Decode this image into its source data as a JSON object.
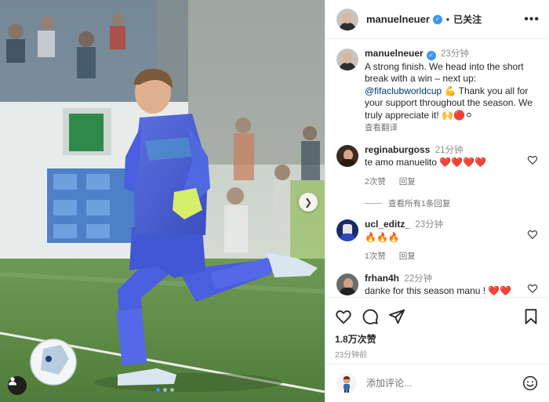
{
  "post": {
    "author": "manuelneuer",
    "follow_label": "已关注",
    "separator": "•",
    "more_label": "•••"
  },
  "caption": {
    "username": "manuelneuer",
    "time": "23分钟",
    "text_before_link": "A strong finish. We head into the short break with a win – next up: ",
    "link": "@fifaclubworldcup",
    "text_after_link": " 💪 Thank you all for your support throughout the season. We truly appreciate it! 🙌🔴⚪",
    "translate_label": "查看翻译"
  },
  "comments": [
    {
      "username": "reginaburgoss",
      "time": "21分钟",
      "text": "te amo manuelito ❤️❤️❤️❤️",
      "likes": "2次赞",
      "reply_label": "回复",
      "avatar_color": "#3b2a22"
    },
    {
      "username": "ucl_editz_",
      "time": "23分钟",
      "text": "🔥🔥🔥",
      "likes": "1次赞",
      "reply_label": "回复",
      "avatar_color": "#1b2a6b"
    },
    {
      "username": "frhan4h",
      "time": "22分钟",
      "text": "danke for this season manu ! ❤️❤️",
      "avatar_color": "#6b6b6b"
    }
  ],
  "view_replies_label": "查看所有1条回复",
  "footer": {
    "likes": "1.8万次赞",
    "time": "23分钟前",
    "comment_placeholder": "添加评论..."
  },
  "colors": {
    "verified": "#3897f0",
    "link": "#00376b",
    "muted": "#8e8e8e",
    "heart_red": "#ed4956"
  },
  "carousel": {
    "current": 1,
    "total": 3
  }
}
